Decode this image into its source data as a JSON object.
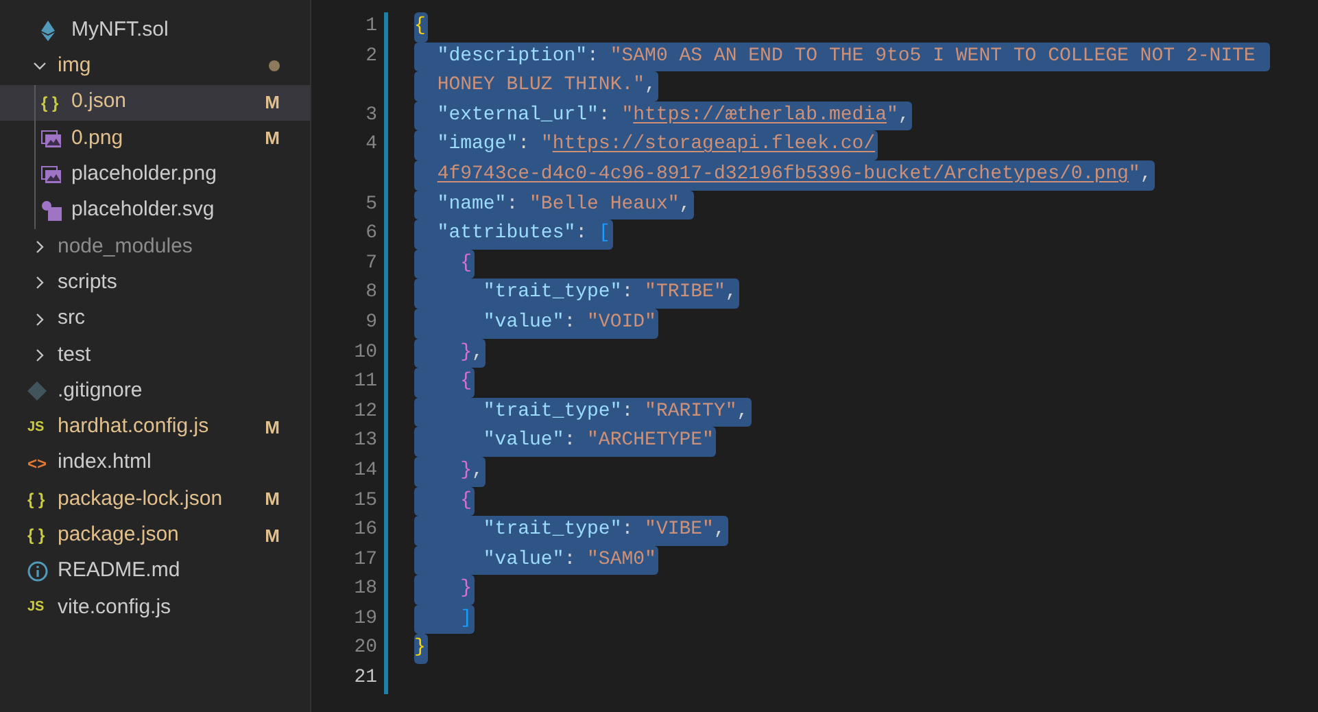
{
  "sidebar": {
    "items": [
      {
        "name": "MyNFT.sol",
        "kind": "solidity",
        "modified": false,
        "selected": false
      },
      {
        "name": "img",
        "kind": "folder",
        "expanded": true,
        "has_changes": true,
        "children": [
          {
            "name": "0.json",
            "kind": "json",
            "glyph": "{ }",
            "modified": true,
            "badge": "M",
            "selected": true
          },
          {
            "name": "0.png",
            "kind": "image",
            "modified": true,
            "badge": "M",
            "selected": false
          },
          {
            "name": "placeholder.png",
            "kind": "image",
            "modified": false,
            "selected": false
          },
          {
            "name": "placeholder.svg",
            "kind": "svg",
            "modified": false,
            "selected": false
          }
        ]
      },
      {
        "name": "node_modules",
        "kind": "folder",
        "expanded": false,
        "ignored": true
      },
      {
        "name": "scripts",
        "kind": "folder",
        "expanded": false,
        "ignored": false
      },
      {
        "name": "src",
        "kind": "folder",
        "expanded": false,
        "ignored": false
      },
      {
        "name": "test",
        "kind": "folder",
        "expanded": false,
        "ignored": false
      },
      {
        "name": ".gitignore",
        "kind": "git",
        "modified": false,
        "selected": false
      },
      {
        "name": "hardhat.config.js",
        "kind": "js",
        "glyph": "JS",
        "modified": true,
        "badge": "M",
        "selected": false
      },
      {
        "name": "index.html",
        "kind": "html",
        "glyph": "<>",
        "modified": false,
        "selected": false
      },
      {
        "name": "package-lock.json",
        "kind": "json",
        "glyph": "{ }",
        "modified": true,
        "badge": "M",
        "selected": false
      },
      {
        "name": "package.json",
        "kind": "json",
        "glyph": "{ }",
        "modified": true,
        "badge": "M",
        "selected": false
      },
      {
        "name": "README.md",
        "kind": "info",
        "modified": false,
        "selected": false
      },
      {
        "name": "vite.config.js",
        "kind": "js",
        "glyph": "JS",
        "modified": false,
        "selected": false
      }
    ]
  },
  "editor": {
    "rows": [
      {
        "number": "1",
        "selected": true,
        "kind": "outer_brace",
        "text": "{"
      },
      {
        "number": "2",
        "selected": true,
        "kind": "pair",
        "key": "  \"description\"",
        "sep": ": ",
        "value": "\"SAM0 AS AN END TO THE 9to5 I WENT TO COLLEGE NOT 2-NITE "
      },
      {
        "selected": true,
        "kind": "wrap",
        "value": "  HONEY BLUZ THINK.\"",
        "trail": ","
      },
      {
        "number": "3",
        "selected": true,
        "kind": "pair_link",
        "key": "  \"external_url\"",
        "sep": ": ",
        "value": "\"https://ætherlab.media\"",
        "trail": ","
      },
      {
        "number": "4",
        "selected": true,
        "kind": "pair_link",
        "key": "  \"image\"",
        "sep": ": ",
        "value": "\"https://storageapi.fleek.co/"
      },
      {
        "selected": true,
        "kind": "wrap_link",
        "value": "  4f9743ce-d4c0-4c96-8917-d32196fb5396-bucket/Archetypes/0.png\"",
        "trail": ","
      },
      {
        "number": "5",
        "selected": true,
        "kind": "pair",
        "key": "  \"name\"",
        "sep": ": ",
        "value": "\"Belle Heaux\"",
        "trail": ","
      },
      {
        "number": "6",
        "selected": true,
        "kind": "pair_open",
        "key": "  \"attributes\"",
        "sep": ": ",
        "value": "["
      },
      {
        "number": "7",
        "selected": true,
        "kind": "inner_brace",
        "text": "    {"
      },
      {
        "number": "8",
        "selected": true,
        "kind": "pair",
        "key": "      \"trait_type\"",
        "sep": ": ",
        "value": "\"TRIBE\"",
        "trail": ","
      },
      {
        "number": "9",
        "selected": true,
        "kind": "pair",
        "key": "      \"value\"",
        "sep": ": ",
        "value": "\"VOID\""
      },
      {
        "number": "10",
        "selected": true,
        "kind": "inner_brace",
        "text": "    },"
      },
      {
        "number": "11",
        "selected": true,
        "kind": "inner_brace",
        "text": "    {"
      },
      {
        "number": "12",
        "selected": true,
        "kind": "pair",
        "key": "      \"trait_type\"",
        "sep": ": ",
        "value": "\"RARITY\"",
        "trail": ","
      },
      {
        "number": "13",
        "selected": true,
        "kind": "pair",
        "key": "      \"value\"",
        "sep": ": ",
        "value": "\"ARCHETYPE\""
      },
      {
        "number": "14",
        "selected": true,
        "kind": "inner_brace",
        "text": "    },"
      },
      {
        "number": "15",
        "selected": true,
        "kind": "inner_brace",
        "text": "    {"
      },
      {
        "number": "16",
        "selected": true,
        "kind": "pair",
        "key": "      \"trait_type\"",
        "sep": ": ",
        "value": "\"VIBE\"",
        "trail": ","
      },
      {
        "number": "17",
        "selected": true,
        "kind": "pair",
        "key": "      \"value\"",
        "sep": ": ",
        "value": "\"SAM0\""
      },
      {
        "number": "18",
        "selected": true,
        "kind": "inner_brace",
        "text": "    }"
      },
      {
        "number": "19",
        "selected": true,
        "kind": "square",
        "text": "    ]"
      },
      {
        "number": "20",
        "selected": true,
        "kind": "outer_brace",
        "text": "}"
      },
      {
        "number": "21",
        "current": true,
        "kind": "empty"
      }
    ]
  }
}
